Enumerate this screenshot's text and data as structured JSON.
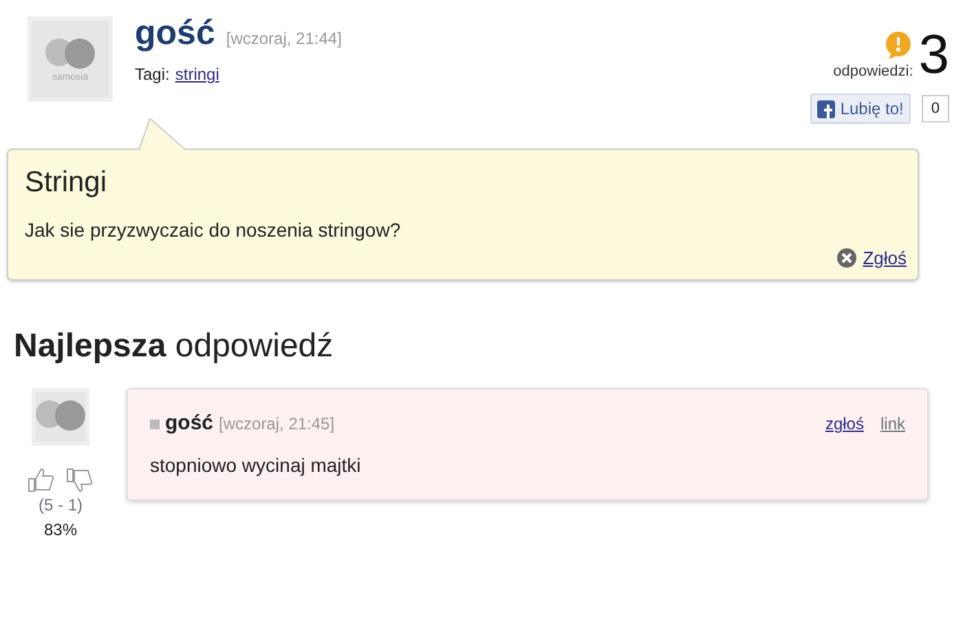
{
  "question": {
    "author": "gość",
    "date": "[wczoraj, 21:44]",
    "avatar_logo": "samosia",
    "tags_label": "Tagi:",
    "tags": [
      "stringi"
    ],
    "answers_label": "odpowiedzi:",
    "answers_count": "3",
    "like_button": "Lubię to!",
    "like_count": "0",
    "title": "Stringi",
    "body": "Jak sie przyzwyczaic do noszenia stringow?",
    "report": "Zgłoś"
  },
  "best_answer": {
    "heading": "**Najlepsza** odpowiedź",
    "votes": "(5 - 1)",
    "percent": "83%",
    "author": "gość",
    "date": "[wczoraj, 21:45]",
    "report": "zgłoś",
    "link": "link",
    "body": "stopniowo wycinaj majtki"
  }
}
